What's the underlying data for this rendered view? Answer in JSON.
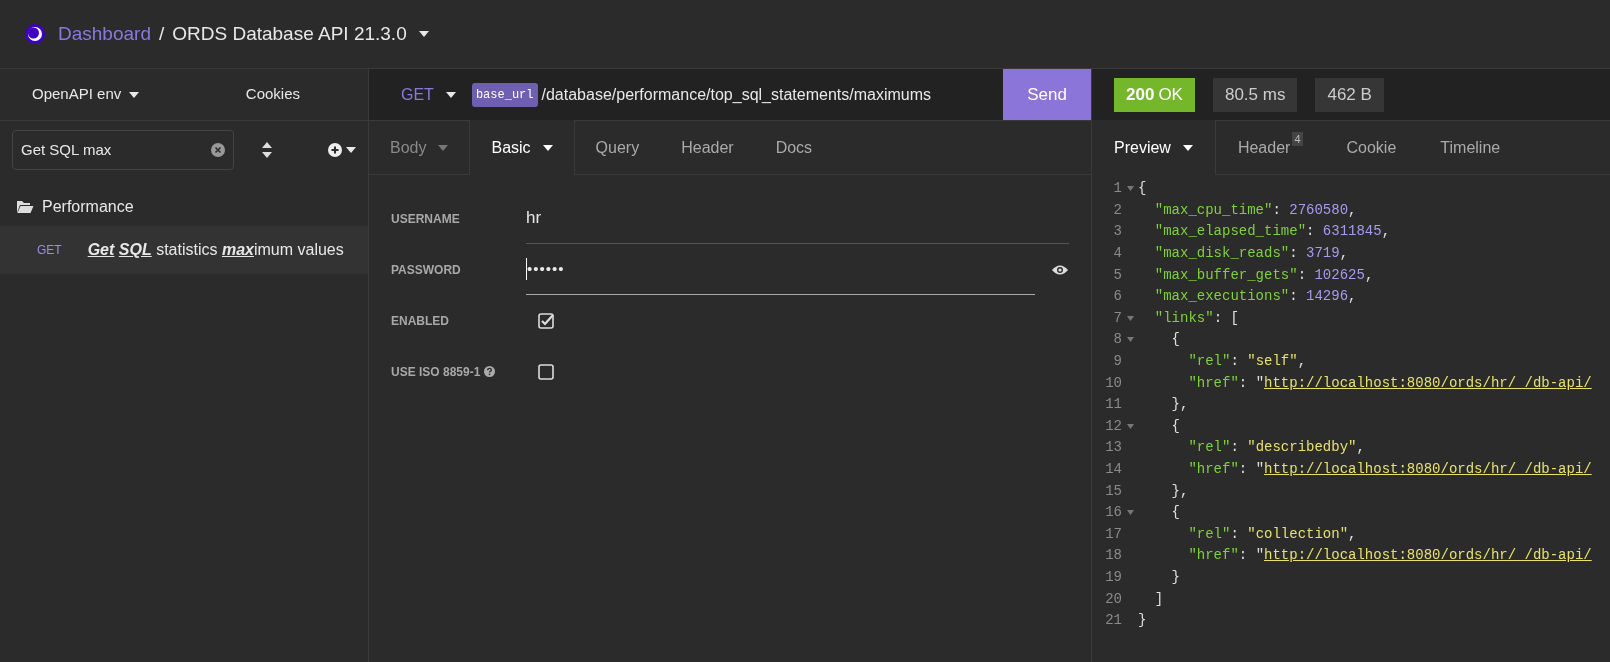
{
  "header": {
    "breadcrumb_link": "Dashboard",
    "separator": "/",
    "title": "ORDS Database API 21.3.0"
  },
  "sidebar": {
    "environment": "OpenAPI env",
    "cookies": "Cookies",
    "filter": {
      "value": "Get SQL max"
    },
    "folders": [
      {
        "name": "Performance",
        "expanded": true,
        "items": [
          {
            "method": "GET",
            "label": "**Get** **SQL** statistics **max**imum values",
            "selected": true
          }
        ]
      }
    ]
  },
  "request": {
    "method": "GET",
    "variable": "base_url",
    "path": "/database/performance/top_sql_statements/maximums",
    "send": "Send",
    "tabs": [
      {
        "label": "Body",
        "selected": false,
        "dropdown": true,
        "disabled": true
      },
      {
        "label": "Basic",
        "selected": true,
        "dropdown": true,
        "disabled": false
      },
      {
        "label": "Query",
        "selected": false,
        "dropdown": false,
        "disabled": false
      },
      {
        "label": "Header",
        "selected": false,
        "dropdown": false,
        "disabled": false
      },
      {
        "label": "Docs",
        "selected": false,
        "dropdown": false,
        "disabled": false
      }
    ],
    "fields": [
      {
        "kind": "text",
        "label": "USERNAME",
        "value": "hr"
      },
      {
        "kind": "password",
        "label": "PASSWORD",
        "value": "••••••"
      },
      {
        "kind": "checkbox",
        "label": "ENABLED",
        "checked": true,
        "help": false
      },
      {
        "kind": "checkbox",
        "label": "USE ISO 8859-1",
        "checked": false,
        "help": true
      }
    ]
  },
  "response": {
    "status": "200",
    "status_text": "OK",
    "time": "80.5 ms",
    "size": "462 B",
    "tabs": [
      {
        "label": "Preview",
        "selected": true,
        "dropdown": true
      },
      {
        "label": "Header",
        "selected": false,
        "dropdown": false,
        "badge": "4"
      },
      {
        "label": "Cookie",
        "selected": false,
        "dropdown": false
      },
      {
        "label": "Timeline",
        "selected": false,
        "dropdown": false
      }
    ],
    "lines": [
      {
        "number": "1",
        "fold": true,
        "tokens": [
          {
            "kind": "punct",
            "text": "{"
          }
        ]
      },
      {
        "number": "2",
        "fold": false,
        "tokens": [
          {
            "kind": "key",
            "text": "  \"max_cpu_time\""
          },
          {
            "kind": "punct",
            "text": ": "
          },
          {
            "kind": "number",
            "text": "2760580"
          },
          {
            "kind": "punct",
            "text": ","
          }
        ]
      },
      {
        "number": "3",
        "fold": false,
        "tokens": [
          {
            "kind": "key",
            "text": "  \"max_elapsed_time\""
          },
          {
            "kind": "punct",
            "text": ": "
          },
          {
            "kind": "number",
            "text": "6311845"
          },
          {
            "kind": "punct",
            "text": ","
          }
        ]
      },
      {
        "number": "4",
        "fold": false,
        "tokens": [
          {
            "kind": "key",
            "text": "  \"max_disk_reads\""
          },
          {
            "kind": "punct",
            "text": ": "
          },
          {
            "kind": "number",
            "text": "3719"
          },
          {
            "kind": "punct",
            "text": ","
          }
        ]
      },
      {
        "number": "5",
        "fold": false,
        "tokens": [
          {
            "kind": "key",
            "text": "  \"max_buffer_gets\""
          },
          {
            "kind": "punct",
            "text": ": "
          },
          {
            "kind": "number",
            "text": "102625"
          },
          {
            "kind": "punct",
            "text": ","
          }
        ]
      },
      {
        "number": "6",
        "fold": false,
        "tokens": [
          {
            "kind": "key",
            "text": "  \"max_executions\""
          },
          {
            "kind": "punct",
            "text": ": "
          },
          {
            "kind": "number",
            "text": "14296"
          },
          {
            "kind": "punct",
            "text": ","
          }
        ]
      },
      {
        "number": "7",
        "fold": true,
        "tokens": [
          {
            "kind": "key",
            "text": "  \"links\""
          },
          {
            "kind": "punct",
            "text": ": ["
          }
        ]
      },
      {
        "number": "8",
        "fold": true,
        "tokens": [
          {
            "kind": "punct",
            "text": "    {"
          }
        ]
      },
      {
        "number": "9",
        "fold": false,
        "tokens": [
          {
            "kind": "key",
            "text": "      \"rel\""
          },
          {
            "kind": "punct",
            "text": ": "
          },
          {
            "kind": "string",
            "text": "\"self\""
          },
          {
            "kind": "punct",
            "text": ","
          }
        ]
      },
      {
        "number": "10",
        "fold": false,
        "tokens": [
          {
            "kind": "key",
            "text": "      \"href\""
          },
          {
            "kind": "punct",
            "text": ": \""
          },
          {
            "kind": "link",
            "text": "http://localhost:8080/ords/hr/_/db-api/"
          }
        ]
      },
      {
        "number": "11",
        "fold": false,
        "tokens": [
          {
            "kind": "punct",
            "text": "    },"
          }
        ]
      },
      {
        "number": "12",
        "fold": true,
        "tokens": [
          {
            "kind": "punct",
            "text": "    {"
          }
        ]
      },
      {
        "number": "13",
        "fold": false,
        "tokens": [
          {
            "kind": "key",
            "text": "      \"rel\""
          },
          {
            "kind": "punct",
            "text": ": "
          },
          {
            "kind": "string",
            "text": "\"describedby\""
          },
          {
            "kind": "punct",
            "text": ","
          }
        ]
      },
      {
        "number": "14",
        "fold": false,
        "tokens": [
          {
            "kind": "key",
            "text": "      \"href\""
          },
          {
            "kind": "punct",
            "text": ": \""
          },
          {
            "kind": "link",
            "text": "http://localhost:8080/ords/hr/_/db-api/"
          }
        ]
      },
      {
        "number": "15",
        "fold": false,
        "tokens": [
          {
            "kind": "punct",
            "text": "    },"
          }
        ]
      },
      {
        "number": "16",
        "fold": true,
        "tokens": [
          {
            "kind": "punct",
            "text": "    {"
          }
        ]
      },
      {
        "number": "17",
        "fold": false,
        "tokens": [
          {
            "kind": "key",
            "text": "      \"rel\""
          },
          {
            "kind": "punct",
            "text": ": "
          },
          {
            "kind": "string",
            "text": "\"collection\""
          },
          {
            "kind": "punct",
            "text": ","
          }
        ]
      },
      {
        "number": "18",
        "fold": false,
        "tokens": [
          {
            "kind": "key",
            "text": "      \"href\""
          },
          {
            "kind": "punct",
            "text": ": \""
          },
          {
            "kind": "link",
            "text": "http://localhost:8080/ords/hr/_/db-api/"
          }
        ]
      },
      {
        "number": "19",
        "fold": false,
        "tokens": [
          {
            "kind": "punct",
            "text": "    }"
          }
        ]
      },
      {
        "number": "20",
        "fold": false,
        "tokens": [
          {
            "kind": "punct",
            "text": "  ]"
          }
        ]
      },
      {
        "number": "21",
        "fold": false,
        "tokens": [
          {
            "kind": "punct",
            "text": "}"
          }
        ]
      }
    ]
  }
}
